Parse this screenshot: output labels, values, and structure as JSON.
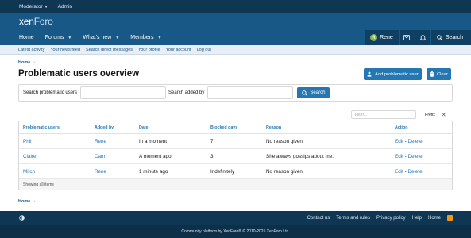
{
  "staffbar": {
    "moderator": "Moderator",
    "admin": "Admin"
  },
  "brand": {
    "xen": "xen",
    "foro": "Foro"
  },
  "nav": {
    "tabs": [
      {
        "label": "Home",
        "dropdown": false
      },
      {
        "label": "Forums",
        "dropdown": true
      },
      {
        "label": "What's new",
        "dropdown": true
      },
      {
        "label": "Members",
        "dropdown": true
      }
    ],
    "user": "Rene",
    "avatar_letter": "R",
    "search": "Search"
  },
  "subnav": [
    "Latest activity",
    "Your news feed",
    "Search direct messages",
    "Your profile",
    "Your account",
    "Log out"
  ],
  "breadcrumb": {
    "home": "Home"
  },
  "page": {
    "title": "Problematic users overview",
    "add_button": "Add problematic user",
    "clear_button": "Clear"
  },
  "search": {
    "label_user": "Search problematic users",
    "label_added": "Search added by",
    "button": "Search",
    "value_user": "",
    "value_added": ""
  },
  "filter": {
    "placeholder": "Filter...",
    "prefix": "Prefix",
    "clear": "✕"
  },
  "table": {
    "headers": [
      "Problematic users",
      "Added by",
      "Date",
      "Blocked days",
      "Reason",
      "Action"
    ],
    "rows": [
      {
        "user": "Phil",
        "added_by": "Rene",
        "date": "In a moment",
        "days": "7",
        "reason": "No reason given.",
        "edit": "Edit",
        "delete": "Delete"
      },
      {
        "user": "Claire",
        "added_by": "Cam",
        "date": "A moment ago",
        "days": "3",
        "reason": "She always gossips about me.",
        "edit": "Edit",
        "delete": "Delete"
      },
      {
        "user": "Mitch",
        "added_by": "Rene",
        "date": "1 minute ago",
        "days": "Indefinitely",
        "reason": "No reason given.",
        "edit": "Edit",
        "delete": "Delete"
      }
    ],
    "footer": "Showing all items"
  },
  "footer": {
    "links": [
      "Contact us",
      "Terms and rules",
      "Privacy policy",
      "Help",
      "Home"
    ],
    "copyright": "Community platform by XenForo® © 2010-2025 XenForo Ltd."
  },
  "colors": {
    "primary": "#185886",
    "dark": "#0f3652",
    "link": "#2577b1",
    "button": "#2577b1"
  }
}
